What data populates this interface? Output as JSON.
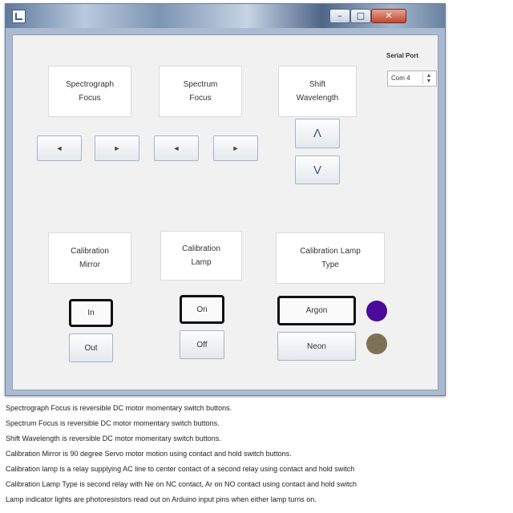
{
  "window": {
    "min_glyph": "–",
    "max_glyph": "□",
    "close_glyph": "✕"
  },
  "serial": {
    "label": "Serial Port",
    "value": "Com 4"
  },
  "spectrograph_focus": {
    "label_line1": "Spectrograph",
    "label_line2": "Focus",
    "left_glyph": "◄",
    "right_glyph": "►"
  },
  "spectrum_focus": {
    "label_line1": "Spectrum",
    "label_line2": "Focus",
    "left_glyph": "◄",
    "right_glyph": "►"
  },
  "shift_wavelength": {
    "label_line1": "Shift",
    "label_line2": "Wavelength",
    "up_label": "Λ",
    "down_label": "V"
  },
  "calibration_mirror": {
    "label_line1": "Calibration",
    "label_line2": "Mirror",
    "in_label": "In",
    "out_label": "Out"
  },
  "calibration_lamp": {
    "label_line1": "Calibration",
    "label_line2": "Lamp",
    "on_label": "On",
    "off_label": "Off"
  },
  "calibration_lamp_type": {
    "label_line1": "Calibration Lamp",
    "label_line2": "Type",
    "argon_label": "Argon",
    "neon_label": "Neon"
  },
  "lamp_indicators": {
    "argon_color": "#4a0a9a",
    "neon_color": "#7d7256"
  },
  "caption": [
    "Spectrograph Focus is reversible DC motor momentary switch buttons.",
    "Spectrum Focus is reversible DC motor momentary switch buttons.",
    "Shift Wavelength is reversible DC motor momentary switch buttons.",
    "Calibration Mirror is 90 degree Servo motor motion using contact and hold switch buttons.",
    "Calibration lamp is a relay supplying AC line to center contact of a second relay using contact and hold switch",
    "Calibration Lamp Type is second relay with Ne on NC contact, Ar on NO contact using contact and hold switch",
    "Lamp indicator lights are photoresistors read out on Arduino input pins when either lamp turns on."
  ]
}
